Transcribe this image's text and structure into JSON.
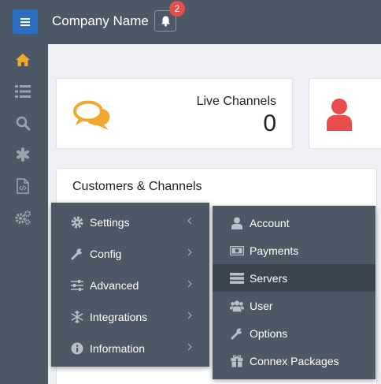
{
  "header": {
    "company_name": "Company Name",
    "notification_count": "2"
  },
  "sidebar": {
    "items": [
      {
        "icon": "home-icon",
        "active": true
      },
      {
        "icon": "list-icon"
      },
      {
        "icon": "search-icon"
      },
      {
        "icon": "asterisk-icon"
      },
      {
        "icon": "code-file-icon"
      },
      {
        "icon": "gears-icon"
      }
    ]
  },
  "stats": {
    "live_channels_label": "Live Channels",
    "live_channels_value": "0"
  },
  "panel": {
    "title": "Customers & Channels"
  },
  "main_menu": {
    "items": [
      {
        "label": "Settings",
        "icon": "gear-icon"
      },
      {
        "label": "Config",
        "icon": "wrench-icon"
      },
      {
        "label": "Advanced",
        "icon": "sliders-icon"
      },
      {
        "label": "Integrations",
        "icon": "snowflake-icon"
      },
      {
        "label": "Information",
        "icon": "info-icon"
      }
    ]
  },
  "submenu": {
    "items": [
      {
        "label": "Account",
        "icon": "user-icon"
      },
      {
        "label": "Payments",
        "icon": "money-icon"
      },
      {
        "label": "Servers",
        "icon": "server-icon",
        "active": true
      },
      {
        "label": "User",
        "icon": "users-icon"
      },
      {
        "label": "Options",
        "icon": "wrench-icon"
      },
      {
        "label": "Connex Packages",
        "icon": "gift-icon"
      }
    ]
  },
  "colors": {
    "topbar": "#4c5865",
    "accent_blue": "#2c6fc2",
    "chat_orange": "#f0a92e",
    "user_red": "#e84c4c",
    "badge_red": "#e74c4c",
    "home_active": "#f0a92e"
  }
}
